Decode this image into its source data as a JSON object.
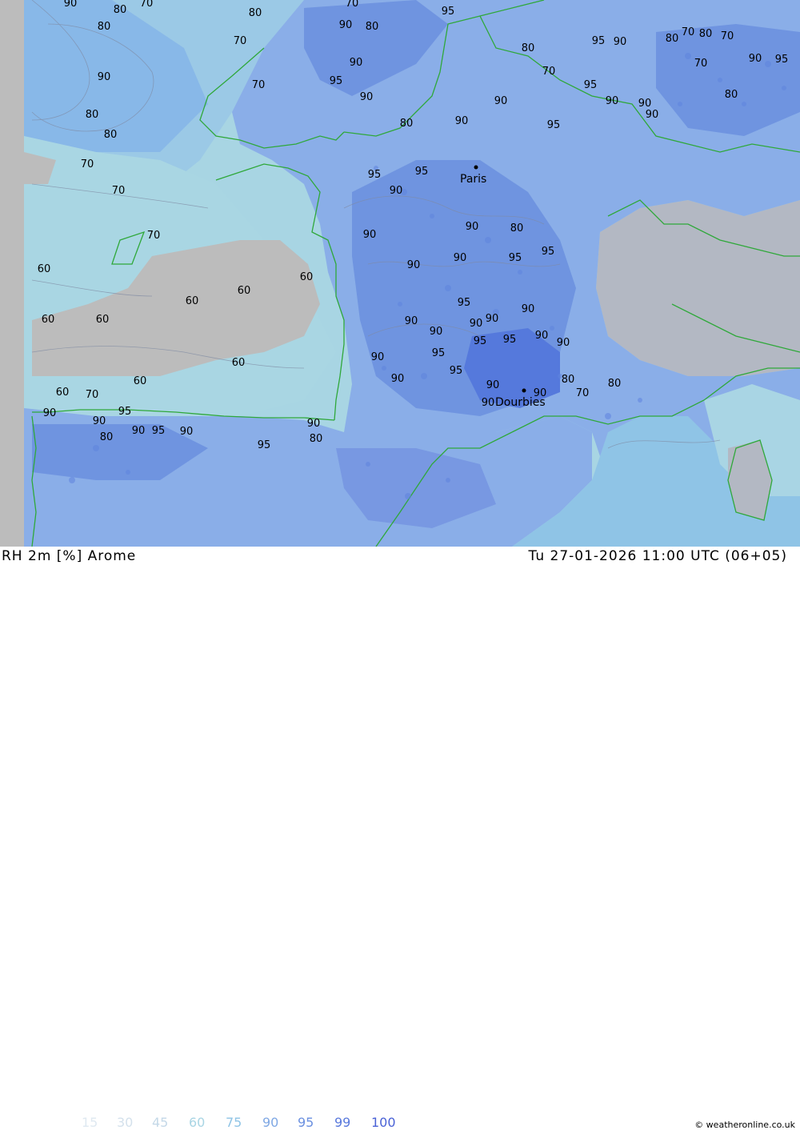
{
  "header": {
    "variable": "RH 2m [%] Arome",
    "datetime": "Tu 27-01-2026 11:00 UTC (06+05)"
  },
  "legend": [
    {
      "label": "15",
      "color": "#dfe9f1"
    },
    {
      "label": "30",
      "color": "#d4e1ec"
    },
    {
      "label": "45",
      "color": "#c4d8e8"
    },
    {
      "label": "60",
      "color": "#a9d5e4"
    },
    {
      "label": "75",
      "color": "#8fc4e6"
    },
    {
      "label": "90",
      "color": "#7fa8e4"
    },
    {
      "label": "95",
      "color": "#6b90e0"
    },
    {
      "label": "99",
      "color": "#5878dc"
    },
    {
      "label": "100",
      "color": "#4a62d6"
    }
  ],
  "cities": [
    {
      "name": "Paris"
    },
    {
      "name": "Dourbies"
    }
  ],
  "contour_values": [
    "90",
    "80",
    "70",
    "80",
    "80",
    "70",
    "90",
    "70",
    "80",
    "80",
    "70",
    "70",
    "70",
    "60",
    "60",
    "60",
    "60",
    "60",
    "60",
    "60",
    "60",
    "60",
    "70",
    "70",
    "80",
    "90",
    "95",
    "90",
    "95",
    "90",
    "80",
    "90",
    "95",
    "90",
    "95",
    "90",
    "80",
    "90",
    "95",
    "90",
    "90",
    "95",
    "95",
    "90",
    "90",
    "90",
    "90",
    "90",
    "95",
    "95",
    "90",
    "90",
    "95",
    "90",
    "95",
    "90",
    "90",
    "90",
    "80",
    "70",
    "80",
    "90",
    "95",
    "90",
    "80",
    "70",
    "90",
    "95",
    "95",
    "90",
    "90",
    "90",
    "80",
    "70",
    "80",
    "70",
    "70",
    "80",
    "90",
    "95",
    "90",
    "90",
    "95",
    "80",
    "90",
    "95",
    "90",
    "95",
    "90",
    "80",
    "70",
    "60",
    "80",
    "70"
  ],
  "credit": "© weatheronline.co.uk",
  "colors": {
    "land_deep": "#5e84de",
    "land_humid": "#8aaee8",
    "sea_near": "#9fcde4",
    "sea_far": "#a8d5e3",
    "dry": "#bcbcbc",
    "coast": "#2fa83a",
    "contour": "#7f8aa3"
  }
}
